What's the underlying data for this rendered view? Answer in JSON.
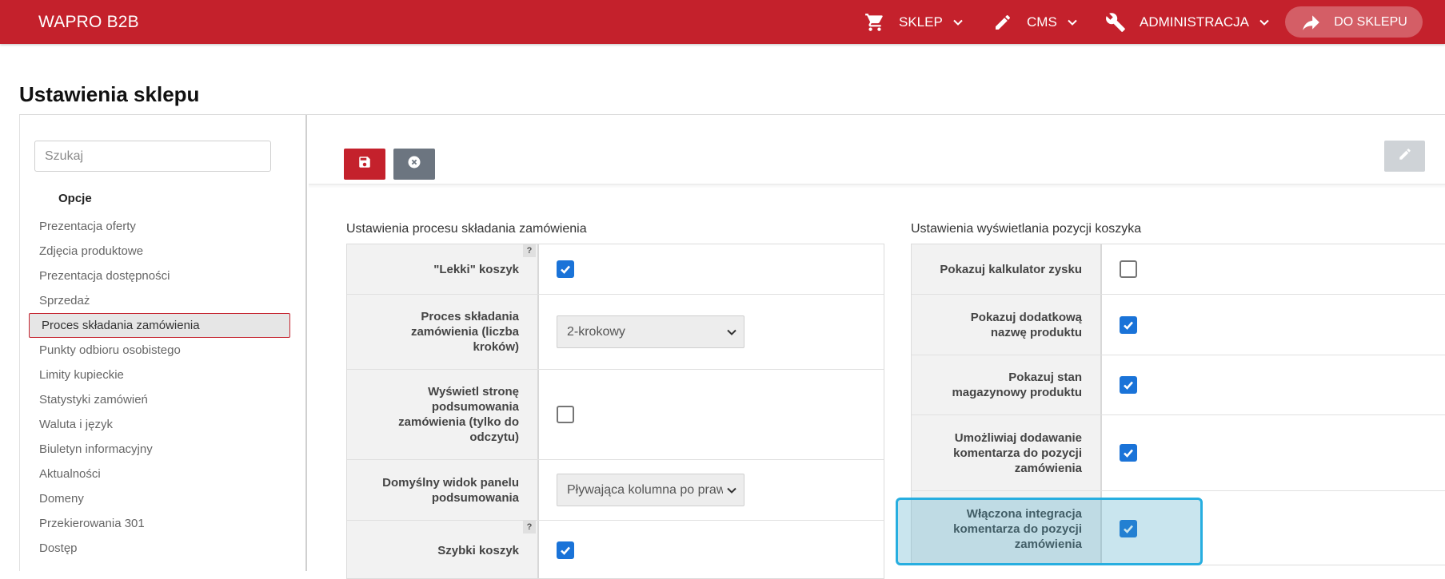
{
  "header": {
    "brand": "WAPRO B2B",
    "nav": [
      {
        "label": "SKLEP",
        "icon": "cart-icon"
      },
      {
        "label": "CMS",
        "icon": "pencil-icon"
      },
      {
        "label": "ADMINISTRACJA",
        "icon": "wrench-icon"
      }
    ],
    "to_shop_label": "DO SKLEPU",
    "accent_color": "#c4212c"
  },
  "page": {
    "title": "Ustawienia sklepu"
  },
  "sidebar": {
    "search_placeholder": "Szukaj",
    "section": "Opcje",
    "items": [
      "Prezentacja oferty",
      "Zdjęcia produktowe",
      "Prezentacja dostępności",
      "Sprzedaż",
      "Proces składania zamówienia",
      "Punkty odbioru osobistego",
      "Limity kupieckie",
      "Statystyki zamówień",
      "Waluta i język",
      "Biuletyn informacyjny",
      "Aktualności",
      "Domeny",
      "Przekierowania 301",
      "Dostęp"
    ],
    "active_index": 4
  },
  "left_panel": {
    "title": "Ustawienia procesu składania zamówienia",
    "rows": [
      {
        "label": "\"Lekki\" koszyk",
        "type": "checkbox",
        "checked": true,
        "help": "?"
      },
      {
        "label": "Proces składania zamówienia (liczba kroków)",
        "type": "select",
        "value": "2-krokowy"
      },
      {
        "label": "Wyświetl stronę podsumowania zamówienia (tylko do odczytu)",
        "type": "checkbox",
        "checked": false
      },
      {
        "label": "Domyślny widok panelu podsumowania",
        "type": "select",
        "value": "Pływająca kolumna po prawej"
      },
      {
        "label": "Szybki koszyk",
        "type": "checkbox",
        "checked": true,
        "help": "?"
      }
    ]
  },
  "right_panel": {
    "title": "Ustawienia wyświetlania pozycji koszyka",
    "rows": [
      {
        "label": "Pokazuj kalkulator zysku",
        "type": "checkbox",
        "checked": false
      },
      {
        "label": "Pokazuj dodatkową nazwę produktu",
        "type": "checkbox",
        "checked": true
      },
      {
        "label": "Pokazuj stan magazynowy produktu",
        "type": "checkbox",
        "checked": true
      },
      {
        "label": "Umożliwiaj dodawanie komentarza do pozycji zamówienia",
        "type": "checkbox",
        "checked": true
      },
      {
        "label": "Włączona integracja komentarza do pozycji zamówienia",
        "type": "checkbox",
        "checked": true
      }
    ]
  }
}
